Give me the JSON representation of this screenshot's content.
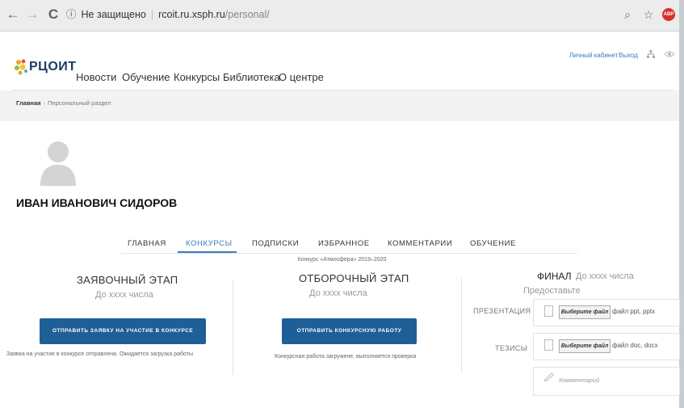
{
  "browser": {
    "back_glyph": "←",
    "forward_glyph": "→",
    "reload_glyph": "C",
    "info_glyph": "ⓘ",
    "security_text": "Не защищено",
    "url_host": "rcoit.ru.xsph.ru",
    "url_path": "/personal/",
    "zoom_glyph": "⌕",
    "star_glyph": "☆",
    "extension_text": "ABP"
  },
  "site": {
    "logo_text": "РЦОИТ",
    "top_links": {
      "cabinet": "Личный кабинет",
      "logout": "Выход"
    },
    "nav": [
      "Новости",
      "Обучение",
      "Конкурсы",
      "Библиотека",
      "О центре"
    ]
  },
  "breadcrumbs": {
    "home": "Главная",
    "separator": "›",
    "current": "Персональный раздел"
  },
  "profile": {
    "name": "ИВАН ИВАНОВИЧ СИДОРОВ"
  },
  "tabs": [
    {
      "label": "ГЛАВНАЯ",
      "active": false
    },
    {
      "label": "КОНКУРСЫ",
      "active": true
    },
    {
      "label": "ПОДПИСКИ",
      "active": false
    },
    {
      "label": "ИЗБРАННОЕ",
      "active": false
    },
    {
      "label": "КОММЕНТАРИИ",
      "active": false
    },
    {
      "label": "ОБУЧЕНИЕ",
      "active": false
    }
  ],
  "contest_label": "Конкурс «Атмосфера» 2019–2020",
  "stages": {
    "application": {
      "title": "ЗАЯВОЧНЫЙ ЭТАП",
      "deadline": "До хххх числа",
      "button": "ОТПРАВИТЬ ЗАЯВКУ НА УЧАСТИЕ В КОНКУРСЕ",
      "status": "Заявка на участие в конкурсе отправлена. Ожидается загрузка работы"
    },
    "selection": {
      "title": "ОТБОРОЧНЫЙ ЭТАП",
      "deadline": "До хххх числа",
      "button": "ОТПРАВИТЬ КОНКУРСНУЮ РАБОТУ",
      "status": "Конкурсная работа загружене, выполняется проверка"
    },
    "final": {
      "title": "ФИНАЛ",
      "deadline": "До хххх числа",
      "provide": "Предоставьте",
      "presentation": {
        "label": "ПРЕЗЕНТАЦИЯ",
        "button": "Выберите файл",
        "hint": "файл ppt, pptx"
      },
      "theses": {
        "label": "ТЕЗИСЫ",
        "button": "Выберите файл",
        "hint": "файл doc, docx"
      },
      "comment_placeholder": "Комментарий"
    }
  },
  "colors": {
    "accent": "#3b7bbf",
    "button_bg": "#1f5f98",
    "band_bg": "#f3f3f3"
  }
}
